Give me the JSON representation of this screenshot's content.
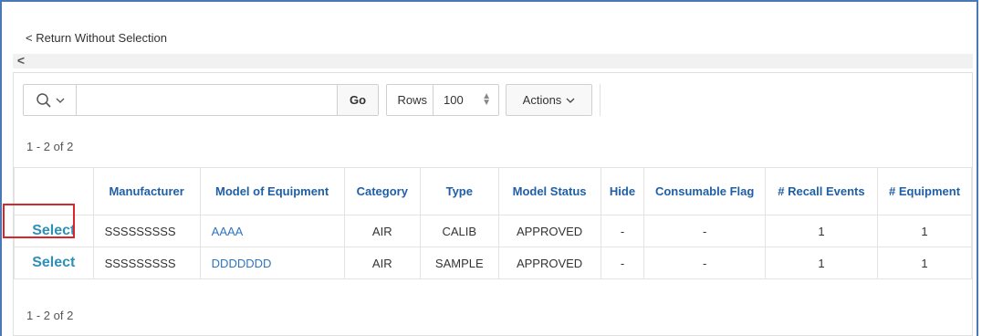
{
  "page": {
    "return_link": "< Return Without Selection",
    "scroll_left": "<"
  },
  "toolbar": {
    "search_icon": "search-icon",
    "search_chevron": "chevron-down-icon",
    "search_value": "",
    "go_label": "Go",
    "rows_label": "Rows",
    "rows_value": "100",
    "actions_label": "Actions"
  },
  "pagination": {
    "top": "1 - 2 of 2",
    "bottom": "1 - 2 of 2"
  },
  "table": {
    "columns": [
      "",
      "Manufacturer",
      "Model of Equipment",
      "Category",
      "Type",
      "Model Status",
      "Hide",
      "Consumable Flag",
      "# Recall Events",
      "# Equipment"
    ],
    "rows": [
      {
        "select": "Select",
        "manufacturer": "SSSSSSSSS",
        "model": "AAAA",
        "category": "AIR",
        "type": "CALIB",
        "status": "APPROVED",
        "hide": "-",
        "consumable": "-",
        "recall_events": "1",
        "equipment": "1"
      },
      {
        "select": "Select",
        "manufacturer": "SSSSSSSSS",
        "model": "DDDDDDD",
        "category": "AIR",
        "type": "SAMPLE",
        "status": "APPROVED",
        "hide": "-",
        "consumable": "-",
        "recall_events": "1",
        "equipment": "1"
      }
    ]
  },
  "colors": {
    "header_text": "#1f5fa6",
    "link": "#2f74c0",
    "select_link": "#2f8fb9",
    "highlight": "#d9262b",
    "frame": "#4a78b5"
  }
}
